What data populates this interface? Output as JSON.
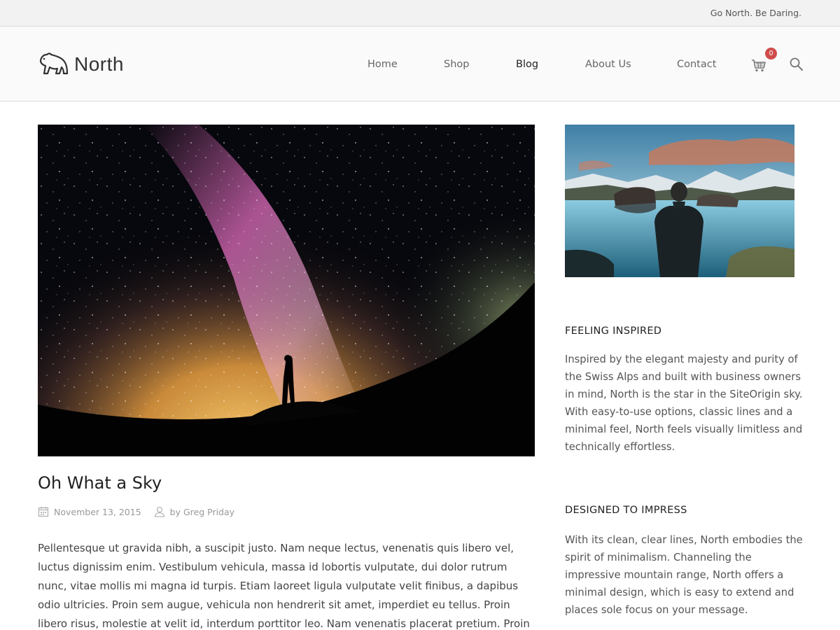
{
  "topbar": {
    "tagline": "Go North. Be Daring."
  },
  "header": {
    "logo_text": "North",
    "nav": [
      {
        "label": "Home",
        "active": false
      },
      {
        "label": "Shop",
        "active": false
      },
      {
        "label": "Blog",
        "active": true
      },
      {
        "label": "About Us",
        "active": false
      },
      {
        "label": "Contact",
        "active": false
      }
    ],
    "cart_count": "0",
    "cart_icon": "shopping-cart-icon",
    "search_icon": "search-icon",
    "badge_color": "#cf4c4c"
  },
  "post": {
    "title": "Oh What a Sky",
    "date": "November 13, 2015",
    "author": "by Greg Priday",
    "excerpt": "Pellentesque ut gravida nibh, a suscipit justo. Nam neque lectus, venenatis quis libero vel, luctus dignissim enim. Vestibulum vehicula, massa id lobortis vulputate, dui dolor rutrum nunc, vitae mollis mi magna id turpis. Etiam laoreet ligula vulputate velit finibus, a dapibus odio ultricies. Proin sem augue, vehicula non hendrerit sit amet, imperdiet eu tellus. Proin libero risus, molestie at velit id, interdum porttitor leo. Nam venenatis placerat pretium. Proin scelerisque augue quam, vel"
  },
  "sidebar": {
    "widgets": [
      {
        "title": "FEELING INSPIRED",
        "text": "Inspired by the elegant majesty and purity of the Swiss Alps and built with business owners in mind, North is the star in the SiteOrigin sky. With easy-to-use options, classic lines and a minimal feel, North feels visually limitless and technically effortless."
      },
      {
        "title": "DESIGNED TO IMPRESS",
        "text": "With its clean, clear lines, North embodies the spirit of minimalism. Channeling the impressive mountain range, North offers a minimal design, which is easy to extend and places sole focus on your message."
      }
    ]
  }
}
